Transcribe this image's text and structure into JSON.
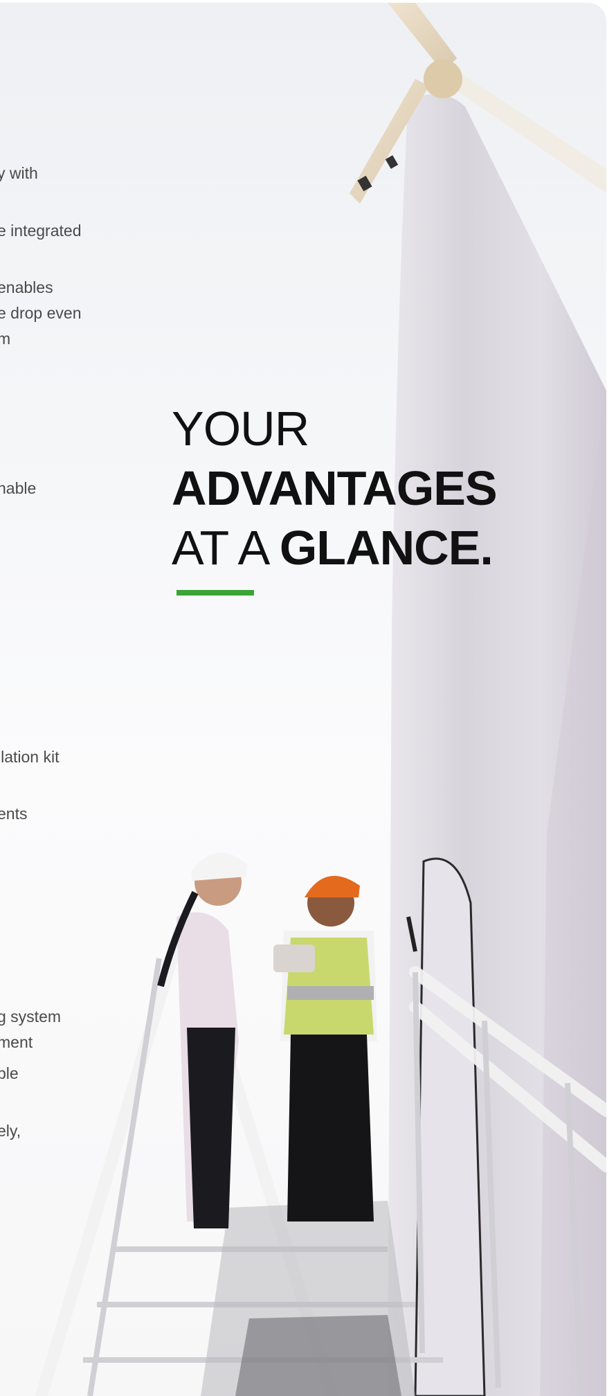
{
  "headline": {
    "line1": "YOUR",
    "line2": "ADVANTAGES",
    "line3_thin": "AT A ",
    "line3_bold": "GLANCE."
  },
  "side_text": [
    "y with",
    "e integrated",
    "enables",
    "e drop even",
    "m",
    "nable",
    "llation kit",
    "ents",
    "g system",
    "ment",
    "ble",
    "ely,"
  ],
  "colors": {
    "accent": "#3aa436",
    "headline": "#111111",
    "body_text": "#4a4a4a",
    "background": "#f4f5f7"
  },
  "illustration": "wind-turbine-with-two-engineers-on-stairs"
}
